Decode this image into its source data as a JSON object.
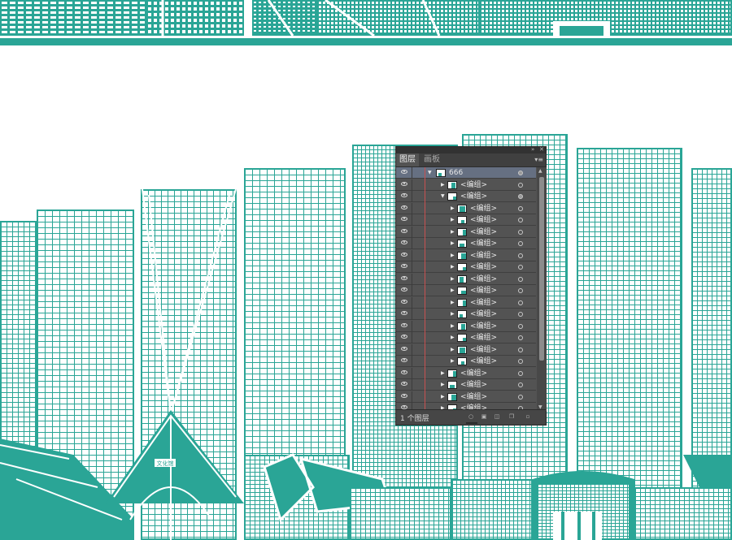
{
  "colors": {
    "teal": "#2aa596",
    "panel_bg": "#535353",
    "selection": "#667082",
    "indent_line": "#c85050"
  },
  "banner_sign": "文化馆",
  "panel": {
    "collapse_icon": "double-chevron-icon",
    "close_icon": "close-icon",
    "menu_icon": "panel-menu-icon",
    "tabs": [
      {
        "label": "图层",
        "active": true
      },
      {
        "label": "画板",
        "active": false
      }
    ],
    "layers": [
      {
        "name": "666",
        "level": 0,
        "expanded": true,
        "selected": true,
        "target_filled": true
      },
      {
        "name": "<编组>",
        "level": 1,
        "expanded": false
      },
      {
        "name": "<编组>",
        "level": 1,
        "expanded": true,
        "target_filled": true
      },
      {
        "name": "<编组>",
        "level": 2,
        "expanded": false
      },
      {
        "name": "<编组>",
        "level": 2,
        "expanded": false
      },
      {
        "name": "<编组>",
        "level": 2,
        "expanded": false
      },
      {
        "name": "<编组>",
        "level": 2,
        "expanded": false
      },
      {
        "name": "<编组>",
        "level": 2,
        "expanded": false
      },
      {
        "name": "<编组>",
        "level": 2,
        "expanded": false
      },
      {
        "name": "<编组>",
        "level": 2,
        "expanded": false
      },
      {
        "name": "<编组>",
        "level": 2,
        "expanded": false
      },
      {
        "name": "<编组>",
        "level": 2,
        "expanded": false
      },
      {
        "name": "<编组>",
        "level": 2,
        "expanded": false
      },
      {
        "name": "<编组>",
        "level": 2,
        "expanded": false
      },
      {
        "name": "<编组>",
        "level": 2,
        "expanded": false
      },
      {
        "name": "<编组>",
        "level": 2,
        "expanded": false
      },
      {
        "name": "<编组>",
        "level": 2,
        "expanded": false
      },
      {
        "name": "<编组>",
        "level": 1,
        "expanded": false
      },
      {
        "name": "<编组>",
        "level": 1,
        "expanded": false
      },
      {
        "name": "<编组>",
        "level": 1,
        "expanded": false
      },
      {
        "name": "<编组>",
        "level": 1,
        "expanded": false
      }
    ],
    "footer": {
      "count": "1 个图层",
      "icons": [
        "locate-object-icon",
        "make-clipping-mask-icon",
        "new-sublayer-icon",
        "new-layer-icon",
        "delete-icon"
      ]
    }
  }
}
